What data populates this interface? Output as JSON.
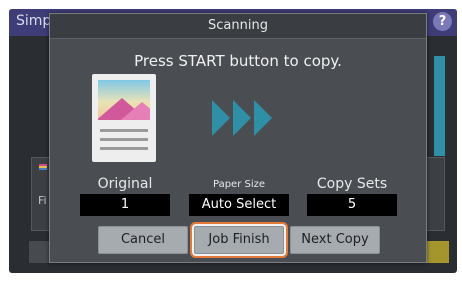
{
  "background": {
    "title": "Simp",
    "left_panel_label": "Fi",
    "help_icon": "?"
  },
  "dialog": {
    "title": "Scanning",
    "instruction": "Press START button to copy.",
    "original": {
      "label": "Original",
      "value": "1"
    },
    "paper_size": {
      "label": "Paper Size",
      "value": "Auto Select"
    },
    "copy_sets": {
      "label": "Copy Sets",
      "value": "5"
    },
    "buttons": {
      "cancel": "Cancel",
      "job_finish": "Job Finish",
      "next_copy": "Next Copy"
    }
  },
  "colors": {
    "header": "#3f3d78",
    "dialog_bg": "#4a4e53",
    "accent_arrows": "#2e8fa6",
    "highlight": "#e07b3b"
  }
}
